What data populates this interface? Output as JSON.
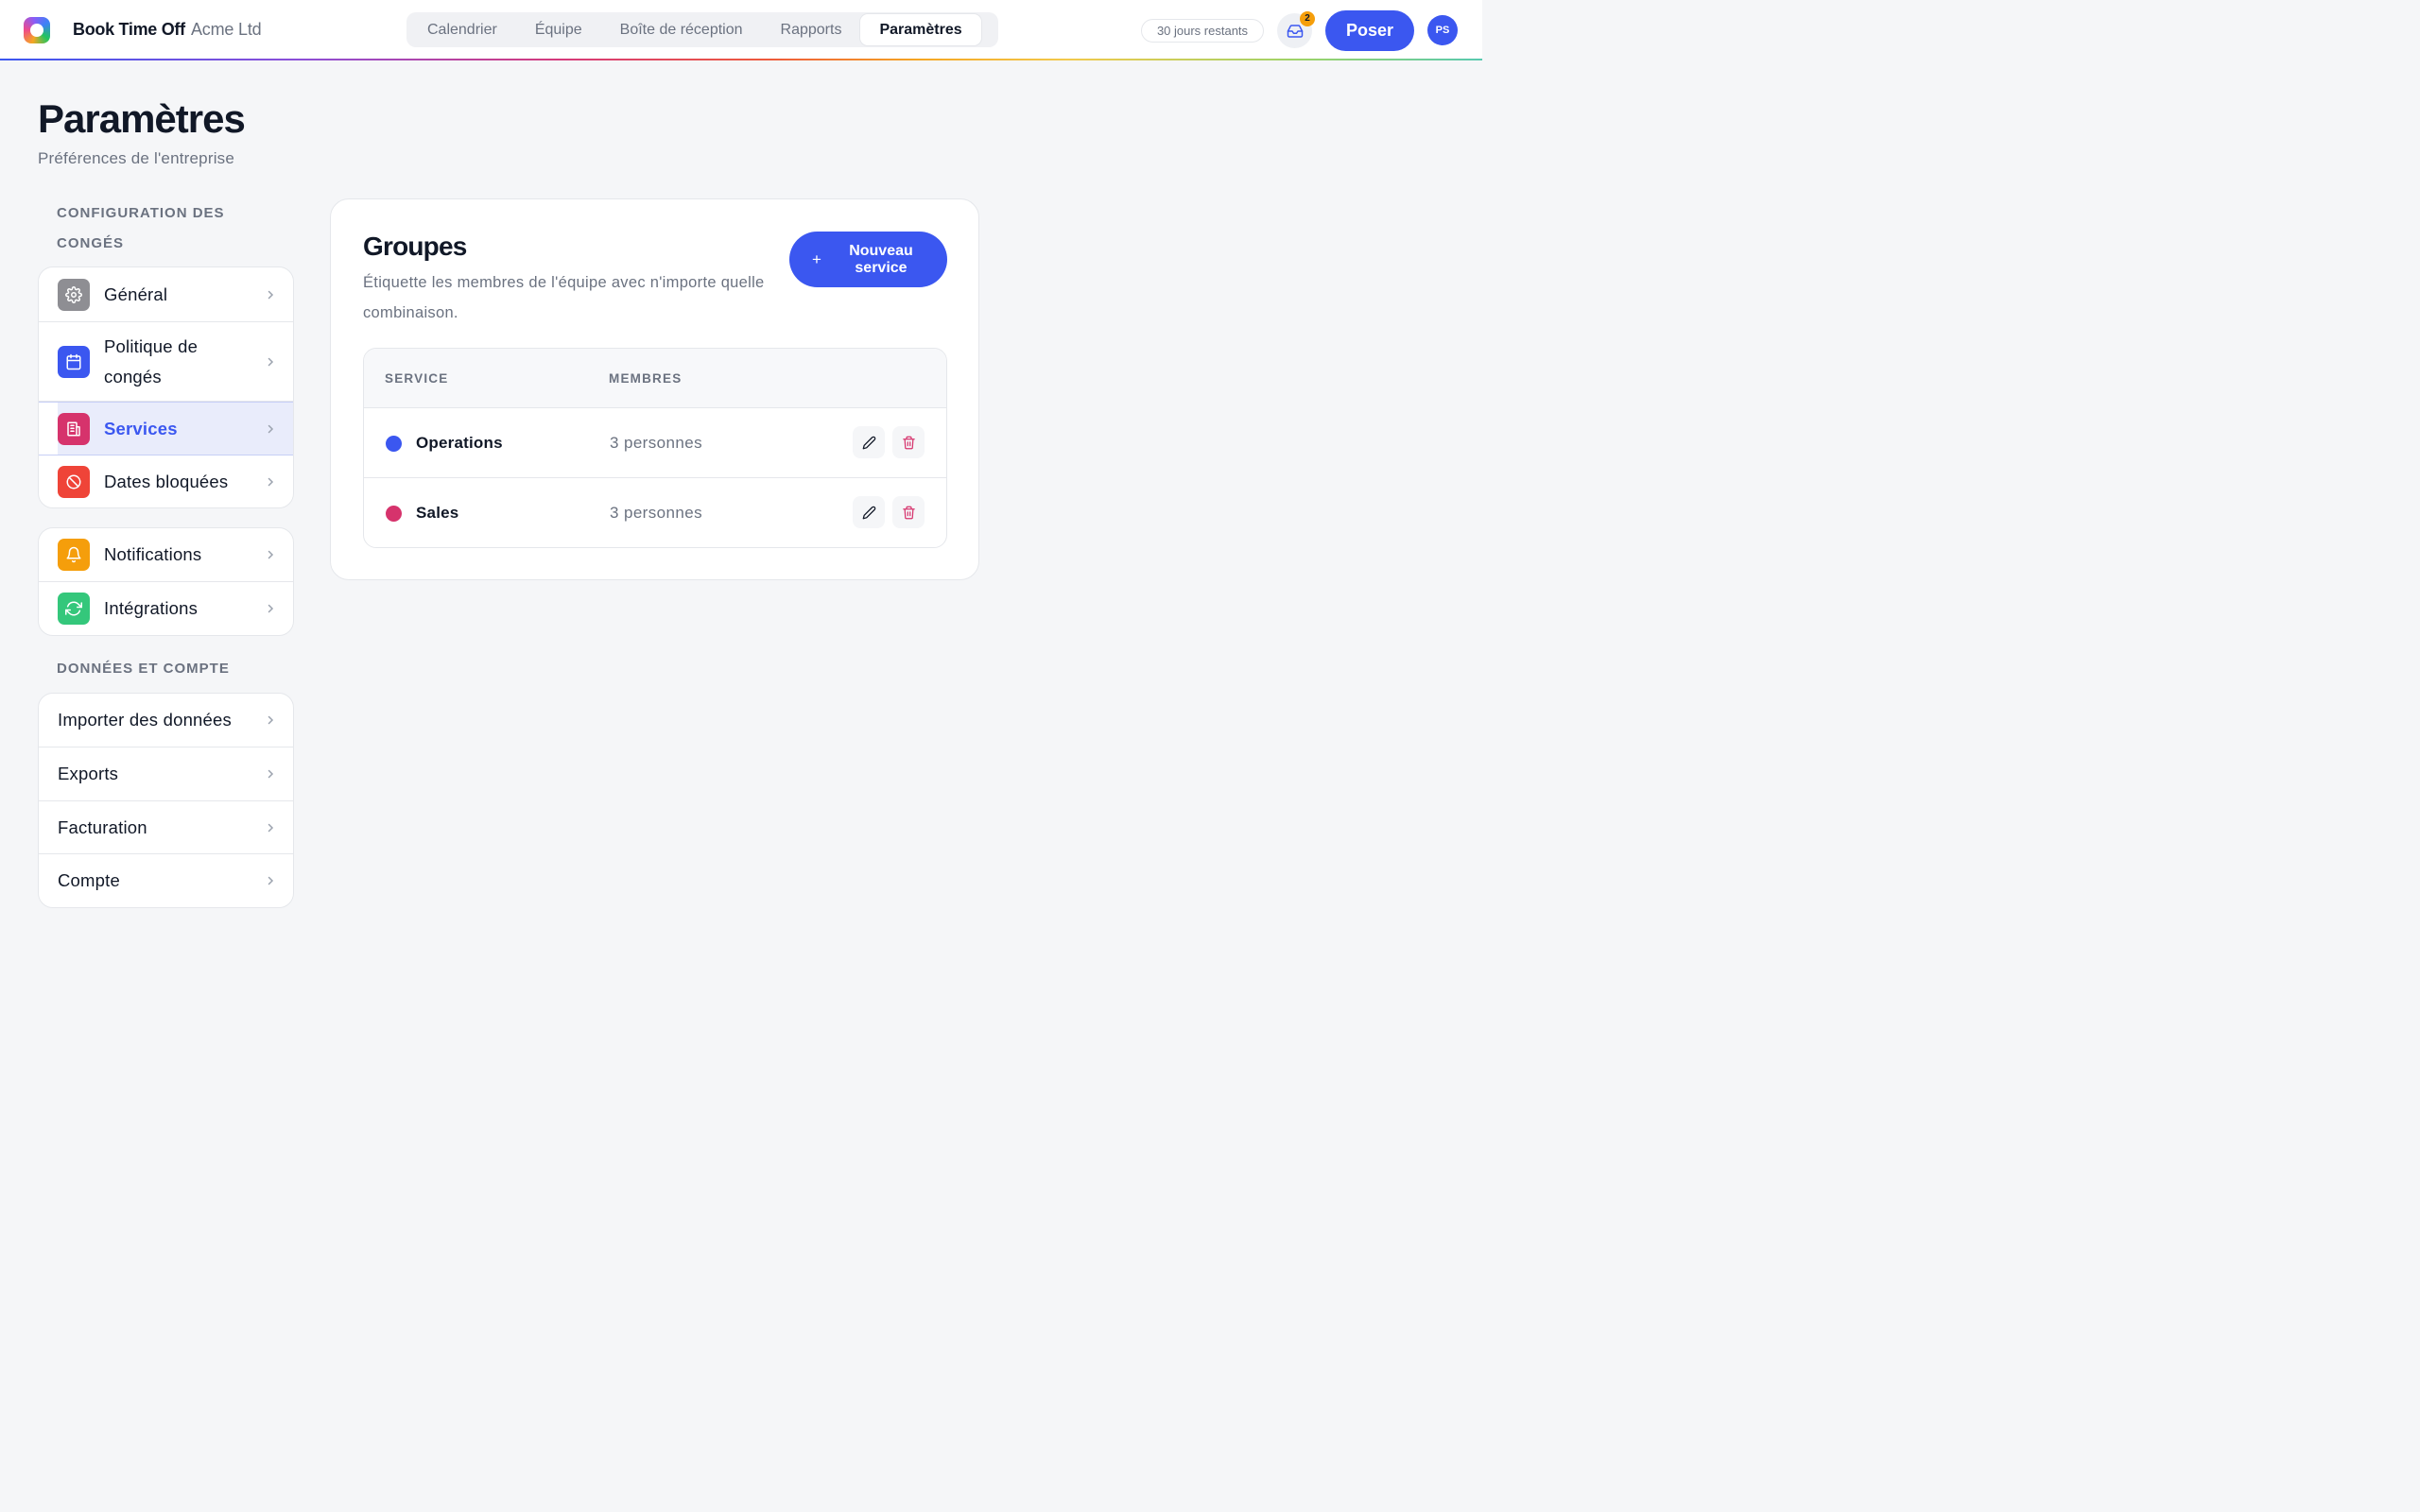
{
  "header": {
    "brand": "Book Time Off",
    "company": "Acme Ltd",
    "tabs": [
      "Calendrier",
      "Équipe",
      "Boîte de réception",
      "Rapports",
      "Paramètres"
    ],
    "active_tab": "Paramètres",
    "days_remaining": "30 jours restants",
    "inbox_count": "2",
    "poser_label": "Poser",
    "avatar_initials": "PS"
  },
  "page": {
    "title": "Paramètres",
    "subtitle": "Préférences de l'entreprise"
  },
  "sidebar": {
    "section1_label": "CONFIGURATION DES CONGÉS",
    "group1": [
      {
        "label": "Général",
        "icon": "gear-icon",
        "color": "#8e8e93"
      },
      {
        "label": "Politique de congés",
        "icon": "calendar-icon",
        "color": "#3b57f0"
      },
      {
        "label": "Services",
        "icon": "building-icon",
        "color": "#d6336c",
        "active": true
      },
      {
        "label": "Dates bloquées",
        "icon": "block-icon",
        "color": "#ef4438"
      }
    ],
    "group2": [
      {
        "label": "Notifications",
        "icon": "bell-icon",
        "color": "#f59e0b"
      },
      {
        "label": "Intégrations",
        "icon": "refresh-icon",
        "color": "#34c77b"
      }
    ],
    "section2_label": "DONNÉES ET COMPTE",
    "group3": [
      {
        "label": "Importer des données"
      },
      {
        "label": "Exports"
      },
      {
        "label": "Facturation"
      },
      {
        "label": "Compte"
      }
    ]
  },
  "main": {
    "title": "Groupes",
    "description": "Étiquette les membres de l'équipe avec n'importe quelle combinaison.",
    "new_button_label": "Nouveau service",
    "new_button_icon": "+",
    "table": {
      "columns": [
        "SERVICE",
        "MEMBRES"
      ],
      "rows": [
        {
          "name": "Operations",
          "members": "3 personnes",
          "color": "#3b57f0"
        },
        {
          "name": "Sales",
          "members": "3 personnes",
          "color": "#d6336c"
        }
      ]
    }
  }
}
